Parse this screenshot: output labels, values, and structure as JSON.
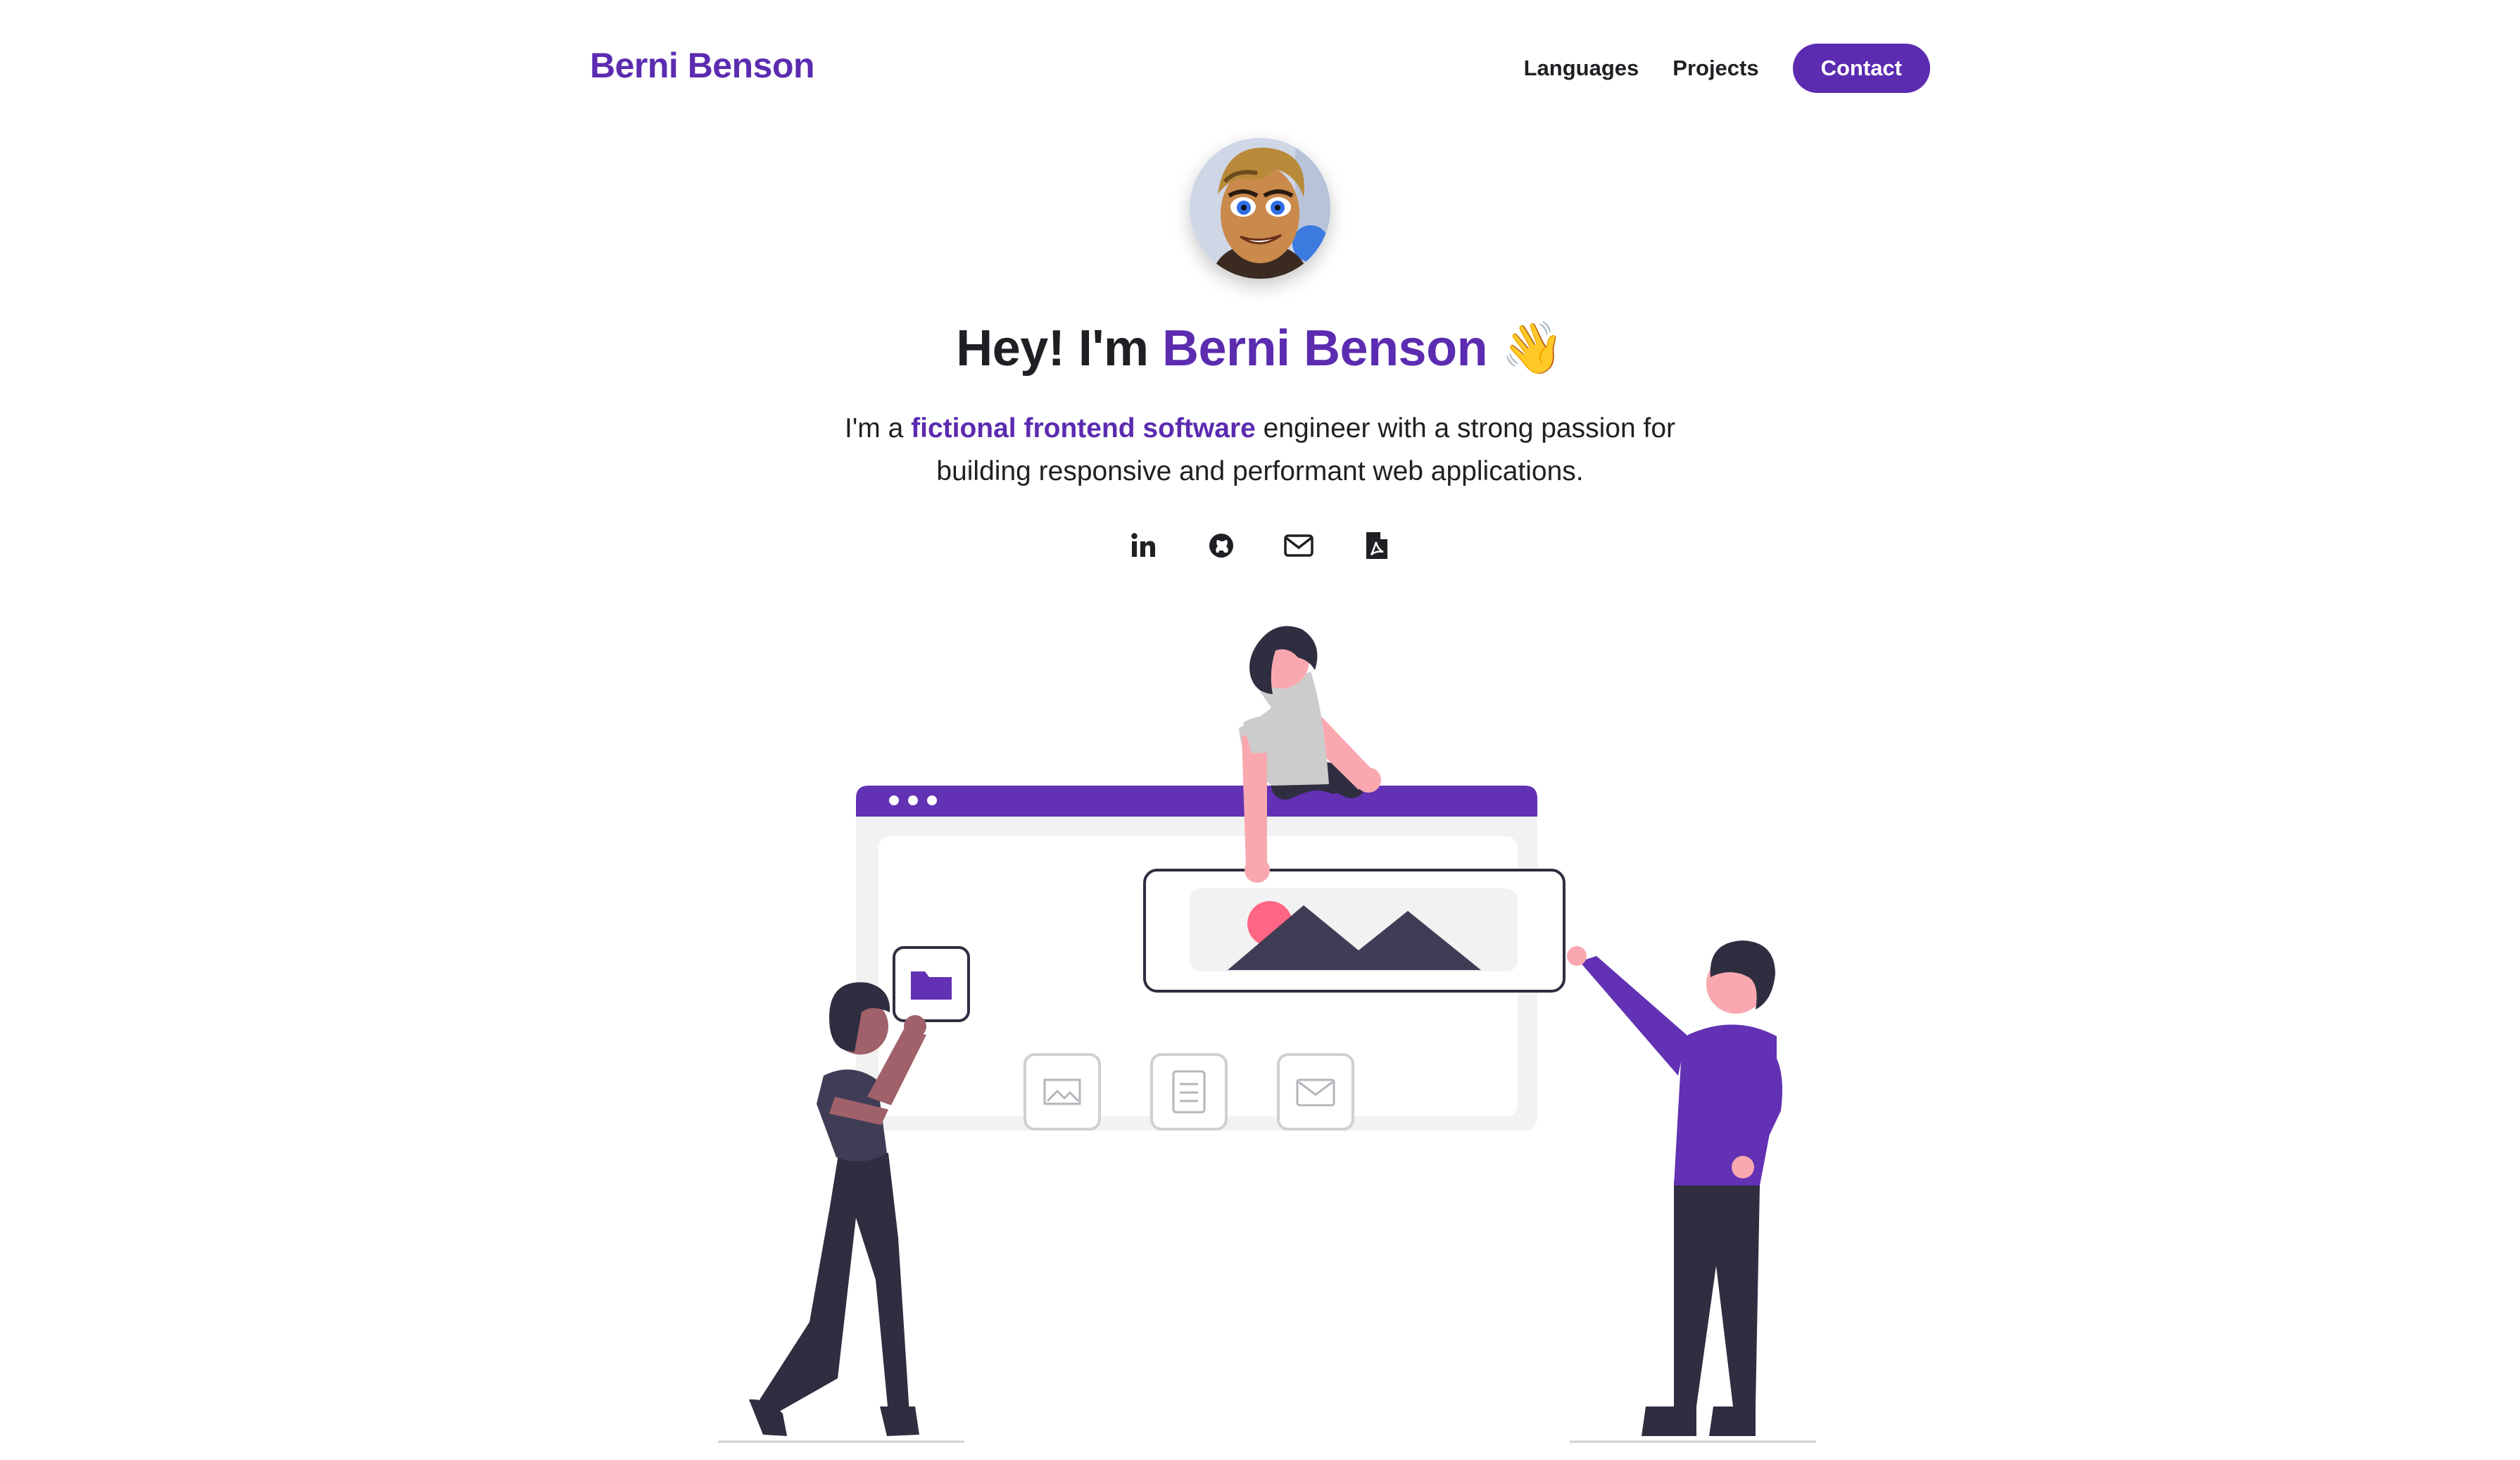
{
  "header": {
    "brand": "Berni Benson",
    "nav": {
      "languages": "Languages",
      "projects": "Projects",
      "contact": "Contact"
    }
  },
  "hero": {
    "headline_prefix": "Hey! I'm ",
    "headline_name": "Berni Benson",
    "headline_emoji": "👋",
    "intro_before": "I'm a ",
    "intro_highlight": "fictional frontend software",
    "intro_after": " engineer with a strong passion for building responsive and performant web applications."
  },
  "socials": [
    {
      "icon": "linkedin-icon"
    },
    {
      "icon": "github-icon"
    },
    {
      "icon": "mail-icon"
    },
    {
      "icon": "pdf-icon"
    }
  ],
  "colors": {
    "accent": "#5b2bb0",
    "text": "#1f1f24",
    "figure_dark": "#2f2e41",
    "skin_pink": "#f9a8b0",
    "panel": "#f2f2f2"
  }
}
